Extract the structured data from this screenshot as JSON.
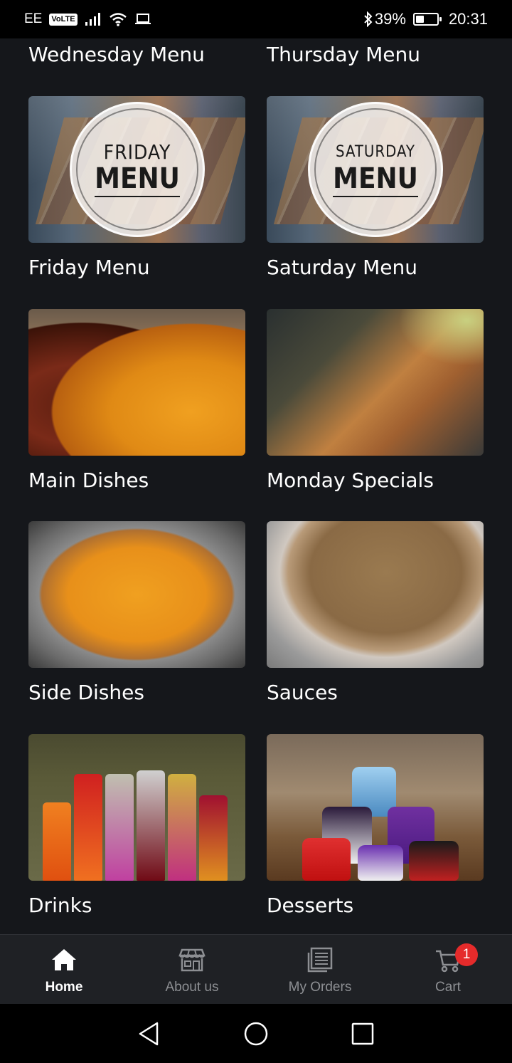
{
  "status_bar": {
    "carrier": "EE",
    "volte": "VoLTE",
    "battery": "39%",
    "battery_level": 0.39,
    "time": "20:31"
  },
  "top_labels": {
    "left": "Wednesday Menu",
    "right": "Thursday Menu"
  },
  "categories": [
    {
      "title": "Friday Menu",
      "image_day": "FRIDAY",
      "image_menu": "MENU"
    },
    {
      "title": "Saturday Menu",
      "image_day": "SATURDAY",
      "image_menu": "MENU"
    },
    {
      "title": "Main Dishes"
    },
    {
      "title": "Monday Specials"
    },
    {
      "title": "Side Dishes"
    },
    {
      "title": "Sauces"
    },
    {
      "title": "Drinks"
    },
    {
      "title": "Desserts"
    }
  ],
  "bottom_nav": {
    "items": [
      {
        "label": "Home",
        "icon": "home-icon",
        "active": true
      },
      {
        "label": "About us",
        "icon": "store-icon",
        "active": false
      },
      {
        "label": "My Orders",
        "icon": "orders-icon",
        "active": false
      },
      {
        "label": "Cart",
        "icon": "cart-icon",
        "active": false
      }
    ],
    "cart_count": "1"
  },
  "colors": {
    "background": "#15171b",
    "nav_background": "#1f2125",
    "badge": "#e52b2b",
    "inactive_label": "#8d8f93"
  }
}
